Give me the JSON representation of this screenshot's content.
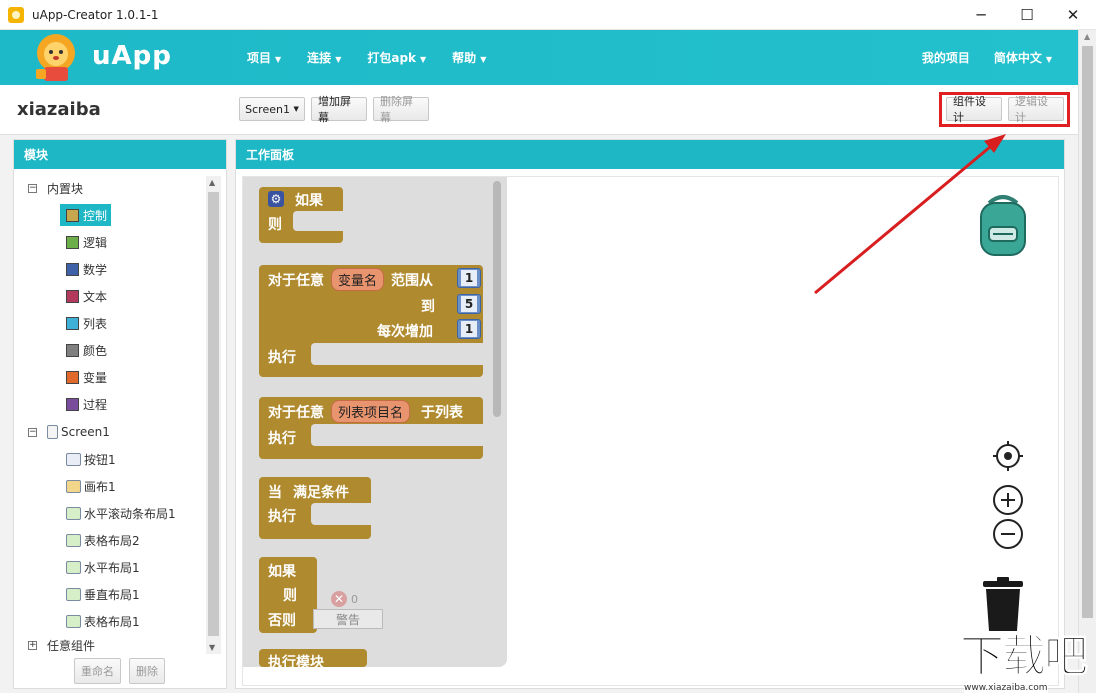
{
  "window": {
    "title": "uApp-Creator 1.0.1-1",
    "controls": {
      "minimize": "─",
      "maximize": "☐",
      "close": "✕"
    }
  },
  "header": {
    "logo_text": "uApp",
    "menu": [
      {
        "label": "项目"
      },
      {
        "label": "连接"
      },
      {
        "label": "打包apk"
      },
      {
        "label": "帮助"
      }
    ],
    "right_menu": {
      "my_projects": "我的项目",
      "language": "简体中文"
    }
  },
  "toolbar": {
    "project_name": "xiazaiba",
    "screen_select": "Screen1",
    "add_screen": "增加屏幕",
    "remove_screen": "删除屏幕",
    "component_design": "组件设计",
    "logic_design": "逻辑设计"
  },
  "left_panel": {
    "title": "模块",
    "builtin_label": "内置块",
    "builtin_items": [
      {
        "label": "控制",
        "color": "#c6a74d"
      },
      {
        "label": "逻辑",
        "color": "#6cae4a"
      },
      {
        "label": "数学",
        "color": "#3f61a8"
      },
      {
        "label": "文本",
        "color": "#b33a5d"
      },
      {
        "label": "列表",
        "color": "#3fb1d6"
      },
      {
        "label": "颜色",
        "color": "#808080"
      },
      {
        "label": "变量",
        "color": "#e06a2c"
      },
      {
        "label": "过程",
        "color": "#7a4d9c"
      }
    ],
    "screen_label": "Screen1",
    "components": [
      {
        "label": "按钮1"
      },
      {
        "label": "画布1"
      },
      {
        "label": "水平滚动条布局1"
      },
      {
        "label": "表格布局2"
      },
      {
        "label": "水平布局1"
      },
      {
        "label": "垂直布局1"
      },
      {
        "label": "表格布局1"
      }
    ],
    "any_component_label": "任意组件",
    "rename_button": "重命名",
    "delete_button": "删除"
  },
  "work_panel": {
    "title": "工作面板",
    "blocks": {
      "if1": {
        "if": "如果",
        "then": "则"
      },
      "for_range": {
        "for_each": "对于任意",
        "var": "变量名",
        "from": "范围从",
        "to": "到",
        "by": "每次增加",
        "do": "执行",
        "from_val": "1",
        "to_val": "5",
        "by_val": "1"
      },
      "for_list": {
        "for_each": "对于任意",
        "var": "列表项目名",
        "in_list": "于列表",
        "do": "执行"
      },
      "while": {
        "while": "当",
        "cond": "满足条件",
        "do": "执行"
      },
      "if2": {
        "if": "如果",
        "then": "则",
        "else": "否则"
      },
      "partial": {
        "label": "执行模块"
      }
    },
    "warnings": {
      "count": "0",
      "label": "警告"
    }
  },
  "watermark": {
    "big": "下载吧",
    "url": "www.xiazaiba.com"
  }
}
